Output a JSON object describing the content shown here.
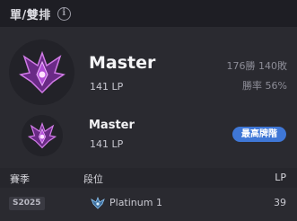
{
  "header": {
    "title": "單/雙排",
    "info_icon": "info-icon"
  },
  "current": {
    "emblem_icon": "master-emblem-icon",
    "rank": "Master",
    "lp": "141 LP",
    "record": "176勝 140敗",
    "winrate": "勝率 56%"
  },
  "peak": {
    "emblem_icon": "master-emblem-icon",
    "rank": "Master",
    "lp": "141 LP",
    "badge": "最高牌階"
  },
  "history": {
    "columns": [
      "賽季",
      "段位",
      "LP"
    ],
    "rows": [
      {
        "season": "S2025",
        "tier_icon": "platinum-emblem-icon",
        "tier": "Platinum 1",
        "lp": "39"
      }
    ]
  },
  "colors": {
    "background": "#1e1e24",
    "panel": "#2a2a30",
    "badge": "#3f77d6",
    "master_purple": "#b04bd6",
    "platinum_blue": "#6fa8e0"
  }
}
